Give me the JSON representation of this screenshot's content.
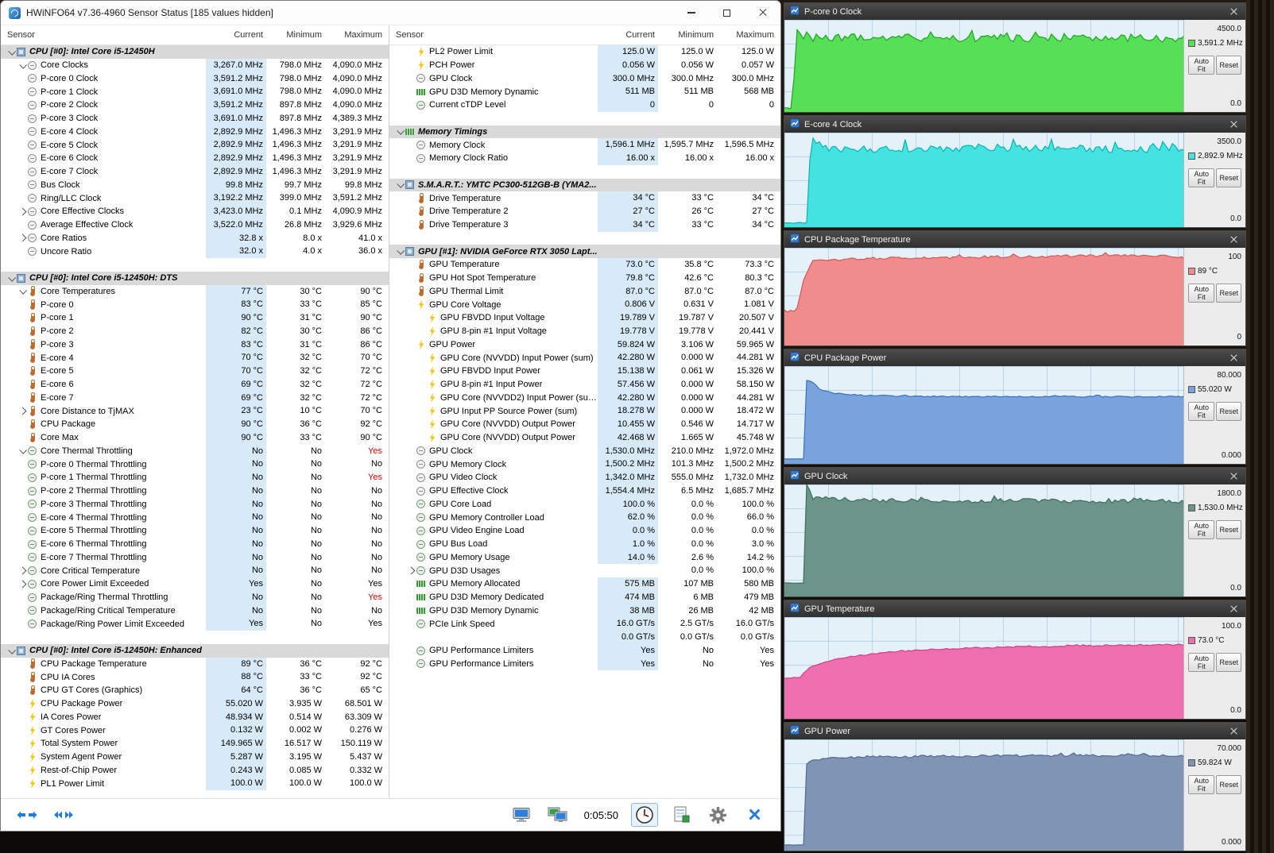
{
  "window": {
    "title": "HWiNFO64 v7.36-4960 Sensor Status [185 values hidden]"
  },
  "columns": [
    "Sensor",
    "Current",
    "Minimum",
    "Maximum"
  ],
  "toolbar": {
    "time": "0:05:50"
  },
  "graph_ui": {
    "auto_fit": "Auto Fit",
    "reset": "Reset"
  },
  "left_rows": [
    {
      "t": "s",
      "a": "d",
      "i": "chip",
      "l": "CPU [#0]: Intel Core i5-12450H"
    },
    {
      "a": "d",
      "i": "clk",
      "l": "Core Clocks",
      "c": "3,267.0 MHz",
      "n": "798.0 MHz",
      "x": "4,090.0 MHz"
    },
    {
      "i": "clk",
      "l": "P-core 0 Clock",
      "c": "3,591.2 MHz",
      "n": "798.0 MHz",
      "x": "4,090.0 MHz"
    },
    {
      "i": "clk",
      "l": "P-core 1 Clock",
      "c": "3,691.0 MHz",
      "n": "798.0 MHz",
      "x": "4,090.0 MHz"
    },
    {
      "i": "clk",
      "l": "P-core 2 Clock",
      "c": "3,591.2 MHz",
      "n": "897.8 MHz",
      "x": "4,090.0 MHz"
    },
    {
      "i": "clk",
      "l": "P-core 3 Clock",
      "c": "3,691.0 MHz",
      "n": "897.8 MHz",
      "x": "4,389.3 MHz"
    },
    {
      "i": "clk",
      "l": "E-core 4 Clock",
      "c": "2,892.9 MHz",
      "n": "1,496.3 MHz",
      "x": "3,291.9 MHz"
    },
    {
      "i": "clk",
      "l": "E-core 5 Clock",
      "c": "2,892.9 MHz",
      "n": "1,496.3 MHz",
      "x": "3,291.9 MHz"
    },
    {
      "i": "clk",
      "l": "E-core 6 Clock",
      "c": "2,892.9 MHz",
      "n": "1,496.3 MHz",
      "x": "3,291.9 MHz"
    },
    {
      "i": "clk",
      "l": "E-core 7 Clock",
      "c": "2,892.9 MHz",
      "n": "1,496.3 MHz",
      "x": "3,291.9 MHz"
    },
    {
      "i": "clk",
      "l": "Bus Clock",
      "c": "99.8 MHz",
      "n": "99.7 MHz",
      "x": "99.8 MHz"
    },
    {
      "i": "clk",
      "l": "Ring/LLC Clock",
      "c": "3,192.2 MHz",
      "n": "399.0 MHz",
      "x": "3,591.2 MHz"
    },
    {
      "a": "r",
      "i": "clk",
      "l": "Core Effective Clocks",
      "c": "3,423.0 MHz",
      "n": "0.1 MHz",
      "x": "4,090.9 MHz"
    },
    {
      "i": "clk",
      "l": "Average Effective Clock",
      "c": "3,522.0 MHz",
      "n": "26.8 MHz",
      "x": "3,929.6 MHz"
    },
    {
      "a": "r",
      "i": "clk",
      "l": "Core Ratios",
      "c": "32.8 x",
      "n": "8.0 x",
      "x": "41.0 x"
    },
    {
      "i": "clk",
      "l": "Uncore Ratio",
      "c": "32.0 x",
      "n": "4.0 x",
      "x": "36.0 x"
    },
    {
      "t": "b"
    },
    {
      "t": "s",
      "a": "d",
      "i": "chip",
      "l": "CPU [#0]: Intel Core i5-12450H: DTS"
    },
    {
      "a": "d",
      "i": "tmp",
      "l": "Core Temperatures",
      "c": "77 °C",
      "n": "30 °C",
      "x": "90 °C"
    },
    {
      "i": "tmp",
      "l": "P-core 0",
      "c": "83 °C",
      "n": "33 °C",
      "x": "85 °C"
    },
    {
      "i": "tmp",
      "l": "P-core 1",
      "c": "90 °C",
      "n": "31 °C",
      "x": "90 °C"
    },
    {
      "i": "tmp",
      "l": "P-core 2",
      "c": "82 °C",
      "n": "30 °C",
      "x": "86 °C"
    },
    {
      "i": "tmp",
      "l": "P-core 3",
      "c": "83 °C",
      "n": "31 °C",
      "x": "86 °C"
    },
    {
      "i": "tmp",
      "l": "E-core 4",
      "c": "70 °C",
      "n": "32 °C",
      "x": "70 °C"
    },
    {
      "i": "tmp",
      "l": "E-core 5",
      "c": "70 °C",
      "n": "32 °C",
      "x": "72 °C"
    },
    {
      "i": "tmp",
      "l": "E-core 6",
      "c": "69 °C",
      "n": "32 °C",
      "x": "72 °C"
    },
    {
      "i": "tmp",
      "l": "E-core 7",
      "c": "69 °C",
      "n": "32 °C",
      "x": "72 °C"
    },
    {
      "a": "r",
      "i": "tmp",
      "l": "Core Distance to TjMAX",
      "c": "23 °C",
      "n": "10 °C",
      "x": "70 °C"
    },
    {
      "i": "tmp",
      "l": "CPU Package",
      "c": "90 °C",
      "n": "36 °C",
      "x": "92 °C"
    },
    {
      "i": "tmp",
      "l": "Core Max",
      "c": "90 °C",
      "n": "33 °C",
      "x": "90 °C"
    },
    {
      "a": "d",
      "i": "cir",
      "l": "Core Thermal Throttling",
      "c": "No",
      "n": "No",
      "x": "Yes",
      "r": true
    },
    {
      "i": "cir",
      "l": "P-core 0 Thermal Throttling",
      "c": "No",
      "n": "No",
      "x": "No"
    },
    {
      "i": "cir",
      "l": "P-core 1 Thermal Throttling",
      "c": "No",
      "n": "No",
      "x": "Yes",
      "r": true
    },
    {
      "i": "cir",
      "l": "P-core 2 Thermal Throttling",
      "c": "No",
      "n": "No",
      "x": "No"
    },
    {
      "i": "cir",
      "l": "P-core 3 Thermal Throttling",
      "c": "No",
      "n": "No",
      "x": "No"
    },
    {
      "i": "cir",
      "l": "E-core 4 Thermal Throttling",
      "c": "No",
      "n": "No",
      "x": "No"
    },
    {
      "i": "cir",
      "l": "E-core 5 Thermal Throttling",
      "c": "No",
      "n": "No",
      "x": "No"
    },
    {
      "i": "cir",
      "l": "E-core 6 Thermal Throttling",
      "c": "No",
      "n": "No",
      "x": "No"
    },
    {
      "i": "cir",
      "l": "E-core 7 Thermal Throttling",
      "c": "No",
      "n": "No",
      "x": "No"
    },
    {
      "a": "r",
      "i": "cir",
      "l": "Core Critical Temperature",
      "c": "No",
      "n": "No",
      "x": "No"
    },
    {
      "a": "r",
      "i": "cir",
      "l": "Core Power Limit Exceeded",
      "c": "Yes",
      "n": "No",
      "x": "Yes"
    },
    {
      "i": "cir",
      "l": "Package/Ring Thermal Throttling",
      "c": "No",
      "n": "No",
      "x": "Yes",
      "r": true
    },
    {
      "i": "cir",
      "l": "Package/Ring Critical Temperature",
      "c": "No",
      "n": "No",
      "x": "No"
    },
    {
      "i": "cir",
      "l": "Package/Ring Power Limit Exceeded",
      "c": "Yes",
      "n": "No",
      "x": "Yes"
    },
    {
      "t": "b"
    },
    {
      "t": "s",
      "a": "d",
      "i": "chip",
      "l": "CPU [#0]: Intel Core i5-12450H: Enhanced"
    },
    {
      "i": "tmp",
      "l": "CPU Package Temperature",
      "c": "89 °C",
      "n": "36 °C",
      "x": "92 °C"
    },
    {
      "i": "tmp",
      "l": "CPU IA Cores",
      "c": "88 °C",
      "n": "33 °C",
      "x": "92 °C"
    },
    {
      "i": "tmp",
      "l": "CPU GT Cores (Graphics)",
      "c": "64 °C",
      "n": "36 °C",
      "x": "65 °C"
    },
    {
      "i": "blt",
      "l": "CPU Package Power",
      "c": "55.020 W",
      "n": "3.935 W",
      "x": "68.501 W"
    },
    {
      "i": "blt",
      "l": "IA Cores Power",
      "c": "48.934 W",
      "n": "0.514 W",
      "x": "63.309 W"
    },
    {
      "i": "blt",
      "l": "GT Cores Power",
      "c": "0.132 W",
      "n": "0.002 W",
      "x": "0.276 W"
    },
    {
      "i": "blt",
      "l": "Total System Power",
      "c": "149.965 W",
      "n": "16.517 W",
      "x": "150.119 W"
    },
    {
      "i": "blt",
      "l": "System Agent Power",
      "c": "5.287 W",
      "n": "3.195 W",
      "x": "5.437 W"
    },
    {
      "i": "blt",
      "l": "Rest-of-Chip Power",
      "c": "0.243 W",
      "n": "0.085 W",
      "x": "0.332 W"
    },
    {
      "i": "blt",
      "l": "PL1 Power Limit",
      "c": "100.0 W",
      "n": "100.0 W",
      "x": "100.0 W"
    }
  ],
  "right_rows": [
    {
      "i": "blt",
      "l": "PL2 Power Limit",
      "c": "125.0 W",
      "n": "125.0 W",
      "x": "125.0 W"
    },
    {
      "i": "blt",
      "l": "PCH Power",
      "c": "0.056 W",
      "n": "0.056 W",
      "x": "0.057 W"
    },
    {
      "i": "clk",
      "l": "GPU Clock",
      "c": "300.0 MHz",
      "n": "300.0 MHz",
      "x": "300.0 MHz"
    },
    {
      "i": "mem",
      "l": "GPU D3D Memory Dynamic",
      "c": "511 MB",
      "n": "511 MB",
      "x": "568 MB"
    },
    {
      "i": "cir",
      "l": "Current cTDP Level",
      "c": "0",
      "n": "0",
      "x": "0"
    },
    {
      "t": "b"
    },
    {
      "t": "s",
      "a": "d",
      "i": "mem",
      "l": "Memory Timings"
    },
    {
      "i": "clk",
      "l": "Memory Clock",
      "c": "1,596.1 MHz",
      "n": "1,595.7 MHz",
      "x": "1,596.5 MHz"
    },
    {
      "i": "clk",
      "l": "Memory Clock Ratio",
      "c": "16.00 x",
      "n": "16.00 x",
      "x": "16.00 x"
    },
    {
      "t": "b"
    },
    {
      "t": "s",
      "a": "d",
      "i": "chip",
      "l": "S.M.A.R.T.: YMTC PC300-512GB-B (YMA2..."
    },
    {
      "i": "tmp",
      "l": "Drive Temperature",
      "c": "34 °C",
      "n": "33 °C",
      "x": "34 °C"
    },
    {
      "i": "tmp",
      "l": "Drive Temperature 2",
      "c": "27 °C",
      "n": "26 °C",
      "x": "27 °C"
    },
    {
      "i": "tmp",
      "l": "Drive Temperature 3",
      "c": "34 °C",
      "n": "33 °C",
      "x": "34 °C"
    },
    {
      "t": "b"
    },
    {
      "t": "s",
      "a": "d",
      "i": "chip",
      "l": "GPU [#1]: NVIDIA GeForce RTX 3050 Lapt..."
    },
    {
      "i": "tmp",
      "l": "GPU Temperature",
      "c": "73.0 °C",
      "n": "35.8 °C",
      "x": "73.3 °C"
    },
    {
      "i": "tmp",
      "l": "GPU Hot Spot Temperature",
      "c": "79.8 °C",
      "n": "42.6 °C",
      "x": "80.3 °C"
    },
    {
      "i": "tmp",
      "l": "GPU Thermal Limit",
      "c": "87.0 °C",
      "n": "87.0 °C",
      "x": "87.0 °C"
    },
    {
      "i": "blt",
      "l": "GPU Core Voltage",
      "c": "0.806 V",
      "n": "0.631 V",
      "x": "1.081 V"
    },
    {
      "d": 1,
      "i": "blt",
      "l": "GPU FBVDD Input Voltage",
      "c": "19.789 V",
      "n": "19.787 V",
      "x": "20.507 V"
    },
    {
      "d": 1,
      "i": "blt",
      "l": "GPU 8-pin #1 Input Voltage",
      "c": "19.778 V",
      "n": "19.778 V",
      "x": "20.441 V"
    },
    {
      "i": "blt",
      "l": "GPU Power",
      "c": "59.824 W",
      "n": "3.106 W",
      "x": "59.965 W"
    },
    {
      "d": 1,
      "i": "blt",
      "l": "GPU Core (NVVDD) Input Power (sum)",
      "c": "42.280 W",
      "n": "0.000 W",
      "x": "44.281 W"
    },
    {
      "d": 1,
      "i": "blt",
      "l": "GPU FBVDD Input Power",
      "c": "15.138 W",
      "n": "0.061 W",
      "x": "15.326 W"
    },
    {
      "d": 1,
      "i": "blt",
      "l": "GPU 8-pin #1 Input Power",
      "c": "57.456 W",
      "n": "0.000 W",
      "x": "58.150 W"
    },
    {
      "d": 1,
      "i": "blt",
      "l": "GPU Core (NVVDD2) Input Power (sum)",
      "c": "42.280 W",
      "n": "0.000 W",
      "x": "44.281 W"
    },
    {
      "d": 1,
      "i": "blt",
      "l": "GPU Input PP Source Power (sum)",
      "c": "18.278 W",
      "n": "0.000 W",
      "x": "18.472 W"
    },
    {
      "d": 1,
      "i": "blt",
      "l": "GPU Core (NVVDD) Output Power",
      "c": "10.455 W",
      "n": "0.546 W",
      "x": "14.717 W"
    },
    {
      "d": 1,
      "i": "blt",
      "l": "GPU Core (NVVDD) Output Power",
      "c": "42.468 W",
      "n": "1.665 W",
      "x": "45.748 W"
    },
    {
      "i": "clk",
      "l": "GPU Clock",
      "c": "1,530.0 MHz",
      "n": "210.0 MHz",
      "x": "1,972.0 MHz"
    },
    {
      "i": "clk",
      "l": "GPU Memory Clock",
      "c": "1,500.2 MHz",
      "n": "101.3 MHz",
      "x": "1,500.2 MHz"
    },
    {
      "i": "clk",
      "l": "GPU Video Clock",
      "c": "1,342.0 MHz",
      "n": "555.0 MHz",
      "x": "1,732.0 MHz"
    },
    {
      "i": "clk",
      "l": "GPU Effective Clock",
      "c": "1,554.4 MHz",
      "n": "6.5 MHz",
      "x": "1,685.7 MHz"
    },
    {
      "i": "cir",
      "l": "GPU Core Load",
      "c": "100.0 %",
      "n": "0.0 %",
      "x": "100.0 %"
    },
    {
      "i": "cir",
      "l": "GPU Memory Controller Load",
      "c": "62.0 %",
      "n": "0.0 %",
      "x": "66.0 %"
    },
    {
      "i": "cir",
      "l": "GPU Video Engine Load",
      "c": "0.0 %",
      "n": "0.0 %",
      "x": "0.0 %"
    },
    {
      "i": "cir",
      "l": "GPU Bus Load",
      "c": "1.0 %",
      "n": "0.0 %",
      "x": "3.0 %"
    },
    {
      "i": "cir",
      "l": "GPU Memory Usage",
      "c": "14.0 %",
      "n": "2.6 %",
      "x": "14.2 %"
    },
    {
      "a": "r",
      "i": "cir",
      "l": "GPU D3D Usages",
      "c": "",
      "n": "0.0 %",
      "x": "100.0 %"
    },
    {
      "i": "mem",
      "l": "GPU Memory Allocated",
      "c": "575 MB",
      "n": "107 MB",
      "x": "580 MB"
    },
    {
      "i": "mem",
      "l": "GPU D3D Memory Dedicated",
      "c": "474 MB",
      "n": "6 MB",
      "x": "479 MB"
    },
    {
      "i": "mem",
      "l": "GPU D3D Memory Dynamic",
      "c": "38 MB",
      "n": "26 MB",
      "x": "42 MB"
    },
    {
      "i": "cir",
      "l": "PCIe Link Speed",
      "c": "16.0 GT/s",
      "n": "2.5 GT/s",
      "x": "16.0 GT/s"
    },
    {
      "l": "",
      "c": "0.0 GT/s",
      "n": "0.0 GT/s",
      "x": "0.0 GT/s"
    },
    {
      "i": "cir",
      "l": "GPU Performance Limiters",
      "c": "Yes",
      "n": "No",
      "x": "Yes"
    },
    {
      "i": "cir",
      "l": "GPU Performance Limiters",
      "c": "Yes",
      "n": "No",
      "x": "Yes"
    }
  ],
  "graphs": [
    {
      "title": "P-core 0 Clock",
      "top_scale": "4500.0",
      "bottom_scale": "0.0",
      "current": "3,591.2 MHz",
      "fill": "#58df58",
      "line": "#1da41d",
      "noise": 0.045,
      "profile": [
        [
          0,
          0.04
        ],
        [
          0.022,
          0.04
        ],
        [
          0.027,
          0.86
        ],
        [
          0.08,
          0.8
        ],
        [
          0.3,
          0.81
        ],
        [
          0.5,
          0.8
        ],
        [
          0.7,
          0.81
        ],
        [
          0.9,
          0.8
        ],
        [
          1,
          0.8
        ]
      ]
    },
    {
      "title": "E-core 4 Clock",
      "top_scale": "3500.0",
      "bottom_scale": "0.0",
      "current": "2,892.9 MHz",
      "fill": "#45e2e2",
      "line": "#09b3b3",
      "noise": 0.04,
      "profile": [
        [
          0,
          0.045
        ],
        [
          0.06,
          0.045
        ],
        [
          0.065,
          0.94
        ],
        [
          0.1,
          0.83
        ],
        [
          0.3,
          0.83
        ],
        [
          0.5,
          0.84
        ],
        [
          0.7,
          0.83
        ],
        [
          1,
          0.826
        ]
      ]
    },
    {
      "title": "CPU Package Temperature",
      "top_scale": "100",
      "bottom_scale": "0",
      "current": "89 °C",
      "fill": "#f18c8c",
      "line": "#d95454",
      "noise": 0.012,
      "profile": [
        [
          0,
          0.35
        ],
        [
          0.03,
          0.36
        ],
        [
          0.05,
          0.7
        ],
        [
          0.07,
          0.87
        ],
        [
          0.2,
          0.89
        ],
        [
          0.4,
          0.9
        ],
        [
          0.6,
          0.91
        ],
        [
          0.8,
          0.92
        ],
        [
          0.93,
          0.92
        ],
        [
          1,
          0.9
        ]
      ]
    },
    {
      "title": "CPU Package Power",
      "top_scale": "80.000",
      "bottom_scale": "0.000",
      "current": "55.020 W",
      "fill": "#79a3dd",
      "line": "#3a6fc0",
      "noise": 0.006,
      "profile": [
        [
          0,
          0.05
        ],
        [
          0.048,
          0.05
        ],
        [
          0.053,
          0.86
        ],
        [
          0.07,
          0.84
        ],
        [
          0.09,
          0.76
        ],
        [
          0.13,
          0.72
        ],
        [
          0.2,
          0.7
        ],
        [
          0.35,
          0.69
        ],
        [
          0.6,
          0.688
        ],
        [
          1,
          0.688
        ]
      ]
    },
    {
      "title": "GPU Clock",
      "top_scale": "1800.0",
      "bottom_scale": "0.0",
      "current": "1,530.0 MHz",
      "fill": "#6c9488",
      "line": "#3c6e5e",
      "noise": 0.018,
      "profile": [
        [
          0,
          0.12
        ],
        [
          0.05,
          0.12
        ],
        [
          0.055,
          1
        ],
        [
          0.07,
          0.88
        ],
        [
          0.2,
          0.86
        ],
        [
          0.4,
          0.85
        ],
        [
          0.6,
          0.86
        ],
        [
          0.8,
          0.85
        ],
        [
          1,
          0.85
        ]
      ]
    },
    {
      "title": "GPU Temperature",
      "top_scale": "100.0",
      "bottom_scale": "0.0",
      "current": "73.0 °C",
      "fill": "#ee6fad",
      "line": "#d63b8b",
      "noise": 0.006,
      "profile": [
        [
          0,
          0.4
        ],
        [
          0.04,
          0.41
        ],
        [
          0.06,
          0.5
        ],
        [
          0.1,
          0.56
        ],
        [
          0.16,
          0.61
        ],
        [
          0.25,
          0.65
        ],
        [
          0.35,
          0.68
        ],
        [
          0.5,
          0.7
        ],
        [
          0.65,
          0.71
        ],
        [
          0.8,
          0.72
        ],
        [
          1,
          0.73
        ]
      ]
    },
    {
      "title": "GPU Power",
      "top_scale": "70.000",
      "bottom_scale": "0.000",
      "current": "59.824 W",
      "fill": "#8094b4",
      "line": "#50689a",
      "noise": 0.01,
      "profile": [
        [
          0,
          0.05
        ],
        [
          0.05,
          0.05
        ],
        [
          0.056,
          0.8
        ],
        [
          0.1,
          0.83
        ],
        [
          0.2,
          0.84
        ],
        [
          0.4,
          0.85
        ],
        [
          0.7,
          0.855
        ],
        [
          1,
          0.855
        ]
      ]
    }
  ]
}
